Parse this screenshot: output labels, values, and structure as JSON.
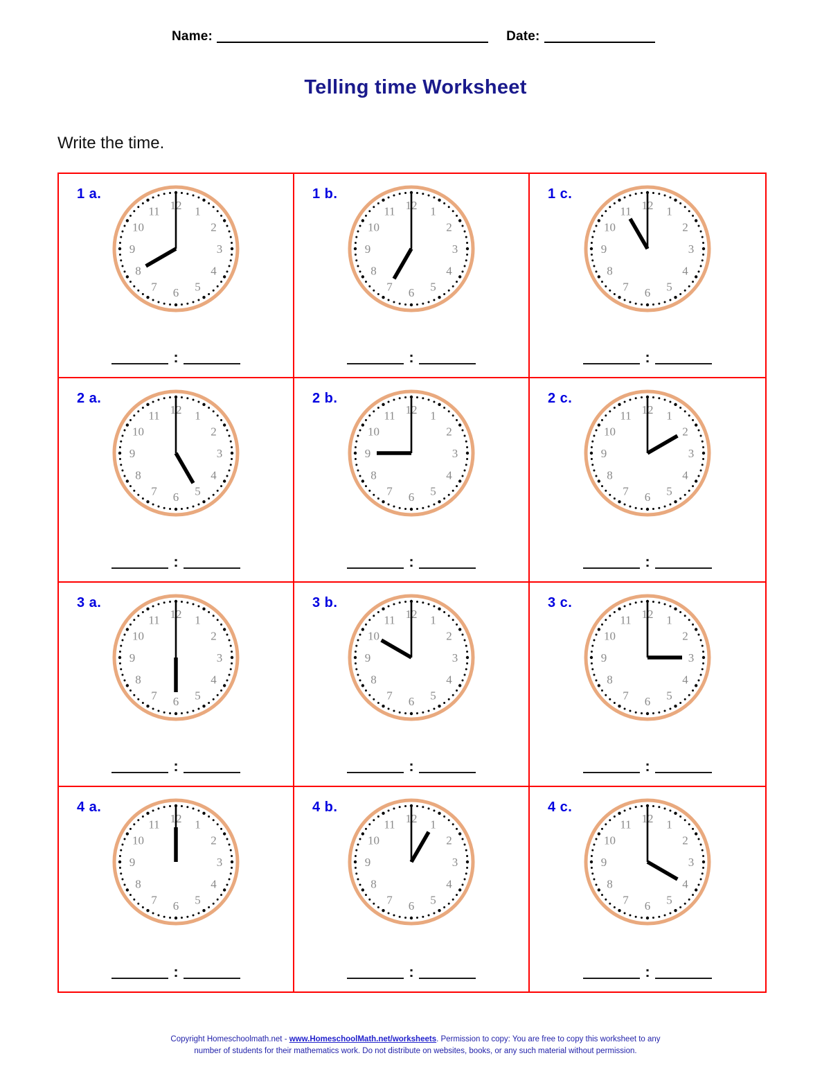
{
  "header": {
    "name_label": "Name:",
    "date_label": "Date:"
  },
  "title": "Telling time Worksheet",
  "instruction": "Write the time.",
  "answer": {
    "colon": ":"
  },
  "problems": [
    {
      "label": "1 a.",
      "hour": 8,
      "minute": 0,
      "time": "8:00"
    },
    {
      "label": "1 b.",
      "hour": 7,
      "minute": 0,
      "time": "7:00"
    },
    {
      "label": "1 c.",
      "hour": 11,
      "minute": 0,
      "time": "11:00"
    },
    {
      "label": "2 a.",
      "hour": 5,
      "minute": 0,
      "time": "5:00"
    },
    {
      "label": "2 b.",
      "hour": 9,
      "minute": 0,
      "time": "9:00"
    },
    {
      "label": "2 c.",
      "hour": 2,
      "minute": 0,
      "time": "2:00"
    },
    {
      "label": "3 a.",
      "hour": 6,
      "minute": 0,
      "time": "6:00"
    },
    {
      "label": "3 b.",
      "hour": 10,
      "minute": 0,
      "time": "10:00"
    },
    {
      "label": "3 c.",
      "hour": 3,
      "minute": 0,
      "time": "3:00"
    },
    {
      "label": "4 a.",
      "hour": 12,
      "minute": 0,
      "time": "12:00"
    },
    {
      "label": "4 b.",
      "hour": 1,
      "minute": 0,
      "time": "1:00"
    },
    {
      "label": "4 c.",
      "hour": 4,
      "minute": 0,
      "time": "4:00"
    }
  ],
  "clock_face": {
    "numerals": [
      "12",
      "1",
      "2",
      "3",
      "4",
      "5",
      "6",
      "7",
      "8",
      "9",
      "10",
      "11"
    ],
    "rim_color": "#e9a97e",
    "numeral_color": "#8a8a8a",
    "hand_color": "#000000",
    "tick_color": "#000000"
  },
  "colors": {
    "grid_border": "#ff0000",
    "title": "#1a1a8c",
    "label": "#0000e0",
    "footer": "#2222aa"
  },
  "footer": {
    "line1_pre": "Copyright Homeschoolmath.net - ",
    "link": "www.HomeschoolMath.net/worksheets",
    "line1_post": ".  Permission to copy: You are free to copy this worksheet to any",
    "line2": "number of students for their mathematics work. Do not distribute on websites, books, or any such material without permission."
  }
}
